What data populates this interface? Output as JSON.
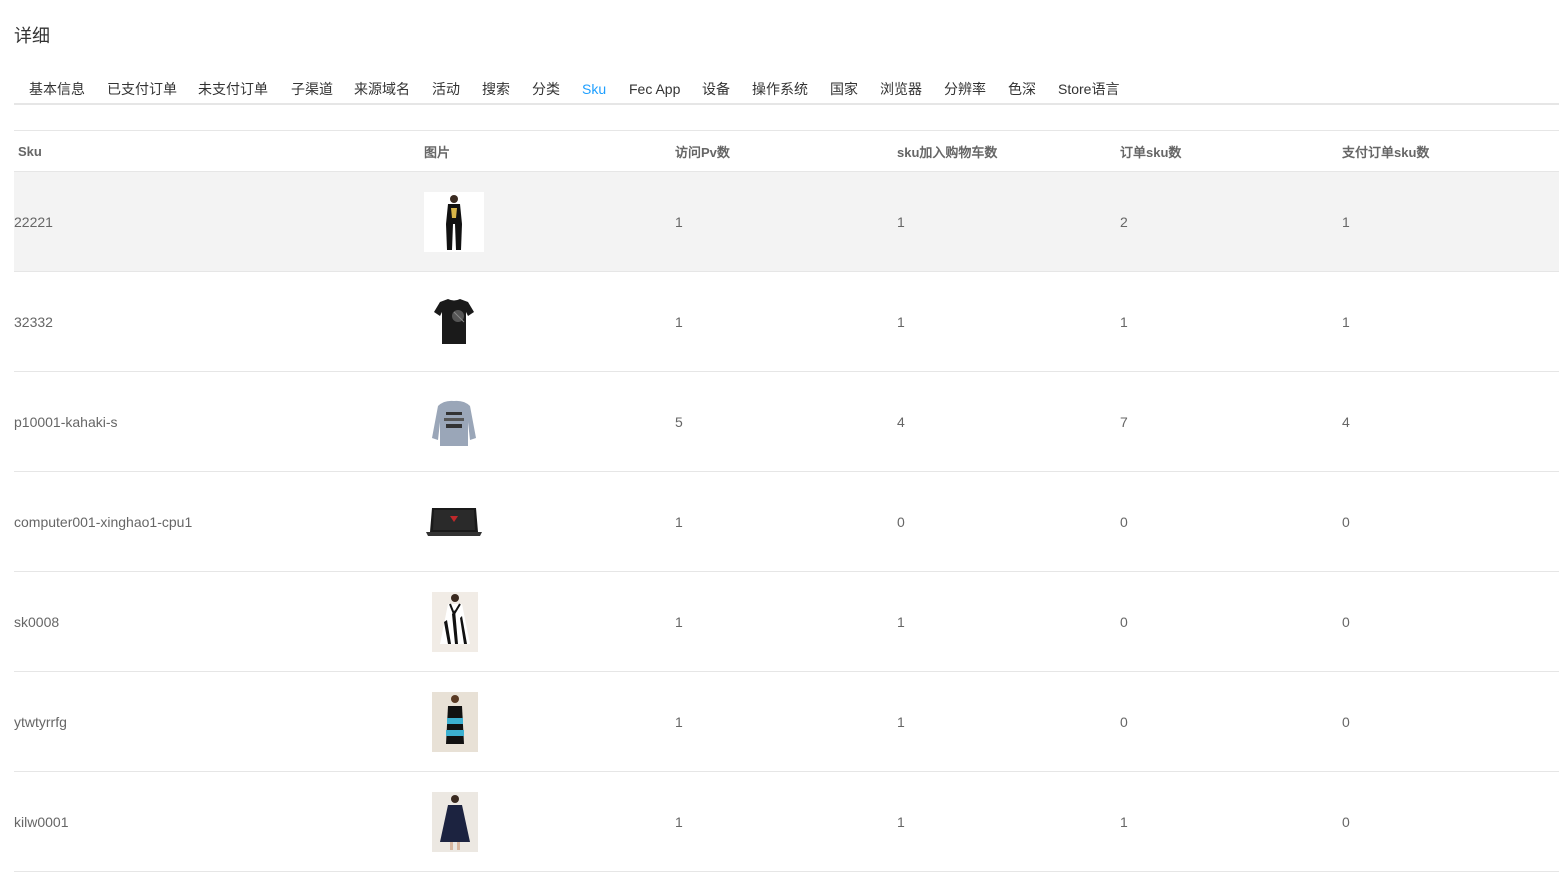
{
  "page": {
    "title": "详细"
  },
  "tabs": [
    {
      "label": "基本信息",
      "active": false
    },
    {
      "label": "已支付订单",
      "active": false
    },
    {
      "label": "未支付订单",
      "active": false
    },
    {
      "label": "子渠道",
      "active": false
    },
    {
      "label": "来源域名",
      "active": false
    },
    {
      "label": "活动",
      "active": false
    },
    {
      "label": "搜索",
      "active": false
    },
    {
      "label": "分类",
      "active": false
    },
    {
      "label": "Sku",
      "active": true
    },
    {
      "label": "Fec App",
      "active": false
    },
    {
      "label": "设备",
      "active": false
    },
    {
      "label": "操作系统",
      "active": false
    },
    {
      "label": "国家",
      "active": false
    },
    {
      "label": "浏览器",
      "active": false
    },
    {
      "label": "分辨率",
      "active": false
    },
    {
      "label": "色深",
      "active": false
    },
    {
      "label": "Store语言",
      "active": false
    }
  ],
  "table": {
    "headers": [
      "Sku",
      "图片",
      "访问Pv数",
      "sku加入购物车数",
      "订单sku数",
      "支付订单sku数"
    ],
    "rows": [
      {
        "sku": "22221",
        "image": "woman-black-outfit-photo",
        "pv": "1",
        "cart": "1",
        "order": "2",
        "paid": "1"
      },
      {
        "sku": "32332",
        "image": "black-tshirt-photo",
        "pv": "1",
        "cart": "1",
        "order": "1",
        "paid": "1"
      },
      {
        "sku": "p10001-kahaki-s",
        "image": "gray-sweatshirt-photo",
        "pv": "5",
        "cart": "4",
        "order": "7",
        "paid": "4"
      },
      {
        "sku": "computer001-xinghao1-cpu1",
        "image": "laptop-photo",
        "pv": "1",
        "cart": "0",
        "order": "0",
        "paid": "0"
      },
      {
        "sku": "sk0008",
        "image": "striped-dress-photo",
        "pv": "1",
        "cart": "1",
        "order": "0",
        "paid": "0"
      },
      {
        "sku": "ytwtyrrfg",
        "image": "blue-black-dress-photo",
        "pv": "1",
        "cart": "1",
        "order": "0",
        "paid": "0"
      },
      {
        "sku": "kilw0001",
        "image": "navy-dress-photo",
        "pv": "1",
        "cart": "1",
        "order": "1",
        "paid": "0"
      }
    ]
  },
  "colors": {
    "accent": "#1e9fff",
    "border": "#e6e6e6",
    "hover_row": "#f3f3f3",
    "text": "#666666"
  }
}
